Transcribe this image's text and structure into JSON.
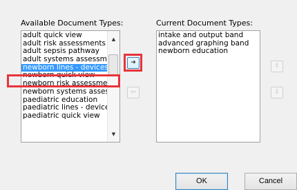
{
  "available": {
    "label": "Available Document Types:",
    "items": [
      "adult quick view",
      "adult risk assessments",
      "adult sepsis pathway",
      "adult systems assessme",
      "newborn lines - devices",
      "newborn quick view",
      "newborn risk assessme",
      "newborn systems asses",
      "paediatric education",
      "paediatric lines - device",
      "paediatric quick view"
    ],
    "selected_item": "newborn lines - devices"
  },
  "current": {
    "label": "Current Document Types:",
    "items": [
      "intake and output band",
      "advanced graphing band",
      "newborn education"
    ]
  },
  "buttons": {
    "add_icon": "right-arrow-icon",
    "remove_icon": "left-arrow-icon",
    "move_up_icon": "up-arrow-icon",
    "move_down_icon": "down-arrow-icon",
    "ok_label": "OK",
    "cancel_label": "Cancel"
  },
  "colors": {
    "selection": "#3399ff",
    "highlight_annotation": "#e8333a"
  }
}
